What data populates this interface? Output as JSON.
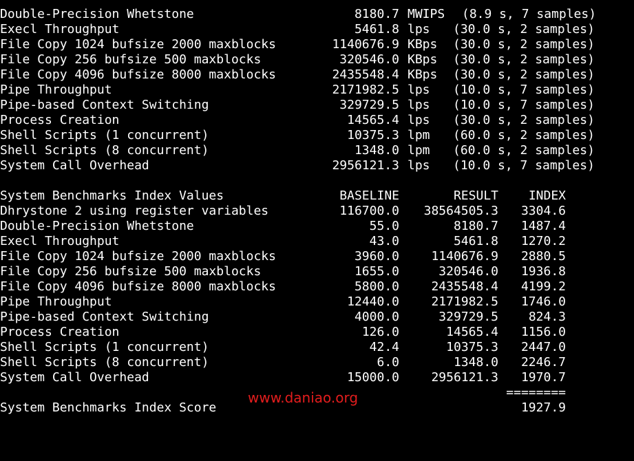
{
  "colors": {
    "background": "#000000",
    "text": "#ffffff",
    "watermark": "#e31d1d"
  },
  "raw_results": [
    {
      "name": "Double-Precision Whetstone",
      "value": "8180.7",
      "unit": "MWIPS",
      "detail": "(8.9 s, 7 samples)"
    },
    {
      "name": "Execl Throughput",
      "value": "5461.8",
      "unit": "lps",
      "detail": "(30.0 s, 2 samples)"
    },
    {
      "name": "File Copy 1024 bufsize 2000 maxblocks",
      "value": "1140676.9",
      "unit": "KBps",
      "detail": "(30.0 s, 2 samples)"
    },
    {
      "name": "File Copy 256 bufsize 500 maxblocks",
      "value": "320546.0",
      "unit": "KBps",
      "detail": "(30.0 s, 2 samples)"
    },
    {
      "name": "File Copy 4096 bufsize 8000 maxblocks",
      "value": "2435548.4",
      "unit": "KBps",
      "detail": "(30.0 s, 2 samples)"
    },
    {
      "name": "Pipe Throughput",
      "value": "2171982.5",
      "unit": "lps",
      "detail": "(10.0 s, 7 samples)"
    },
    {
      "name": "Pipe-based Context Switching",
      "value": "329729.5",
      "unit": "lps",
      "detail": "(10.0 s, 7 samples)"
    },
    {
      "name": "Process Creation",
      "value": "14565.4",
      "unit": "lps",
      "detail": "(30.0 s, 2 samples)"
    },
    {
      "name": "Shell Scripts (1 concurrent)",
      "value": "10375.3",
      "unit": "lpm",
      "detail": "(60.0 s, 2 samples)"
    },
    {
      "name": "Shell Scripts (8 concurrent)",
      "value": "1348.0",
      "unit": "lpm",
      "detail": "(60.0 s, 2 samples)"
    },
    {
      "name": "System Call Overhead",
      "value": "2956121.3",
      "unit": "lps",
      "detail": "(10.0 s, 7 samples)"
    }
  ],
  "index_table": {
    "header": {
      "title": "System Benchmarks Index Values",
      "baseline": "BASELINE",
      "result": "RESULT",
      "index": "INDEX"
    },
    "rows": [
      {
        "name": "Dhrystone 2 using register variables",
        "baseline": "116700.0",
        "result": "38564505.3",
        "index": "3304.6"
      },
      {
        "name": "Double-Precision Whetstone",
        "baseline": "55.0",
        "result": "8180.7",
        "index": "1487.4"
      },
      {
        "name": "Execl Throughput",
        "baseline": "43.0",
        "result": "5461.8",
        "index": "1270.2"
      },
      {
        "name": "File Copy 1024 bufsize 2000 maxblocks",
        "baseline": "3960.0",
        "result": "1140676.9",
        "index": "2880.5"
      },
      {
        "name": "File Copy 256 bufsize 500 maxblocks",
        "baseline": "1655.0",
        "result": "320546.0",
        "index": "1936.8"
      },
      {
        "name": "File Copy 4096 bufsize 8000 maxblocks",
        "baseline": "5800.0",
        "result": "2435548.4",
        "index": "4199.2"
      },
      {
        "name": "Pipe Throughput",
        "baseline": "12440.0",
        "result": "2171982.5",
        "index": "1746.0"
      },
      {
        "name": "Pipe-based Context Switching",
        "baseline": "4000.0",
        "result": "329729.5",
        "index": "824.3"
      },
      {
        "name": "Process Creation",
        "baseline": "126.0",
        "result": "14565.4",
        "index": "1156.0"
      },
      {
        "name": "Shell Scripts (1 concurrent)",
        "baseline": "42.4",
        "result": "10375.3",
        "index": "2447.0"
      },
      {
        "name": "Shell Scripts (8 concurrent)",
        "baseline": "6.0",
        "result": "1348.0",
        "index": "2246.7"
      },
      {
        "name": "System Call Overhead",
        "baseline": "15000.0",
        "result": "2956121.3",
        "index": "1970.7"
      }
    ],
    "separator": "========",
    "score_label": "System Benchmarks Index Score",
    "score_value": "1927.9"
  },
  "watermark": "www.daniao.org"
}
